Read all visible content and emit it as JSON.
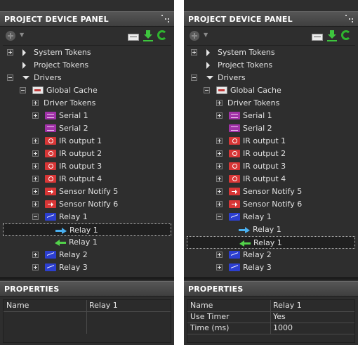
{
  "panels": [
    {
      "title": "PROJECT DEVICE PANEL",
      "tree": [
        {
          "label": "System Tokens",
          "level": 0,
          "expander": "plus",
          "icon": "triangle-right-icon"
        },
        {
          "label": "Project Tokens",
          "level": 0,
          "expander": "",
          "icon": "triangle-right-icon"
        },
        {
          "label": "Drivers",
          "level": 0,
          "expander": "minus",
          "icon": "triangle-down-icon"
        },
        {
          "label": "Global Cache",
          "level": 1,
          "expander": "minus",
          "icon": "device-icon"
        },
        {
          "label": "Driver Tokens",
          "level": 2,
          "expander": "plus",
          "icon": ""
        },
        {
          "label": "Serial 1",
          "level": 2,
          "expander": "plus",
          "icon": "serial-icon"
        },
        {
          "label": "Serial 2",
          "level": 2,
          "expander": "",
          "icon": "serial-icon"
        },
        {
          "label": "IR output 1",
          "level": 2,
          "expander": "plus",
          "icon": "ir-icon"
        },
        {
          "label": "IR output 2",
          "level": 2,
          "expander": "plus",
          "icon": "ir-icon"
        },
        {
          "label": "IR output 3",
          "level": 2,
          "expander": "plus",
          "icon": "ir-icon"
        },
        {
          "label": "IR output 4",
          "level": 2,
          "expander": "plus",
          "icon": "ir-icon"
        },
        {
          "label": "Sensor Notify 5",
          "level": 2,
          "expander": "plus",
          "icon": "sensor-notify-icon"
        },
        {
          "label": "Sensor Notify 6",
          "level": 2,
          "expander": "plus",
          "icon": "sensor-notify-icon"
        },
        {
          "label": "Relay 1",
          "level": 2,
          "expander": "minus",
          "icon": "relay-icon"
        },
        {
          "label": "Relay 1",
          "level": 3,
          "expander": "",
          "icon": "arrow-right-blue-icon",
          "selected": true
        },
        {
          "label": "Relay 1",
          "level": 3,
          "expander": "",
          "icon": "arrow-left-green-icon"
        },
        {
          "label": "Relay 2",
          "level": 2,
          "expander": "plus",
          "icon": "relay-icon"
        },
        {
          "label": "Relay 3",
          "level": 2,
          "expander": "plus",
          "icon": "relay-icon"
        }
      ],
      "properties": {
        "title": "PROPERTIES",
        "rows": [
          {
            "name": "Name",
            "value": "Relay 1"
          }
        ]
      }
    },
    {
      "title": "PROJECT DEVICE PANEL",
      "tree": [
        {
          "label": "System Tokens",
          "level": 0,
          "expander": "plus",
          "icon": "triangle-right-icon"
        },
        {
          "label": "Project Tokens",
          "level": 0,
          "expander": "",
          "icon": "triangle-right-icon"
        },
        {
          "label": "Drivers",
          "level": 0,
          "expander": "minus",
          "icon": "triangle-down-icon"
        },
        {
          "label": "Global Cache",
          "level": 1,
          "expander": "minus",
          "icon": "device-icon"
        },
        {
          "label": "Driver Tokens",
          "level": 2,
          "expander": "plus",
          "icon": ""
        },
        {
          "label": "Serial 1",
          "level": 2,
          "expander": "plus",
          "icon": "serial-icon"
        },
        {
          "label": "Serial 2",
          "level": 2,
          "expander": "",
          "icon": "serial-icon"
        },
        {
          "label": "IR output 1",
          "level": 2,
          "expander": "plus",
          "icon": "ir-icon"
        },
        {
          "label": "IR output 2",
          "level": 2,
          "expander": "plus",
          "icon": "ir-icon"
        },
        {
          "label": "IR output 3",
          "level": 2,
          "expander": "plus",
          "icon": "ir-icon"
        },
        {
          "label": "IR output 4",
          "level": 2,
          "expander": "plus",
          "icon": "ir-icon"
        },
        {
          "label": "Sensor Notify 5",
          "level": 2,
          "expander": "plus",
          "icon": "sensor-notify-icon"
        },
        {
          "label": "Sensor Notify 6",
          "level": 2,
          "expander": "plus",
          "icon": "sensor-notify-icon"
        },
        {
          "label": "Relay 1",
          "level": 2,
          "expander": "minus",
          "icon": "relay-icon"
        },
        {
          "label": "Relay 1",
          "level": 3,
          "expander": "",
          "icon": "arrow-right-blue-icon"
        },
        {
          "label": "Relay 1",
          "level": 3,
          "expander": "",
          "icon": "arrow-left-green-icon",
          "selected": true
        },
        {
          "label": "Relay 2",
          "level": 2,
          "expander": "plus",
          "icon": "relay-icon"
        },
        {
          "label": "Relay 3",
          "level": 2,
          "expander": "plus",
          "icon": "relay-icon"
        }
      ],
      "properties": {
        "title": "PROPERTIES",
        "rows": [
          {
            "name": "Name",
            "value": "Relay 1"
          },
          {
            "name": "Use Timer",
            "value": "Yes"
          },
          {
            "name": "Time (ms)",
            "value": "1000"
          }
        ]
      }
    }
  ]
}
